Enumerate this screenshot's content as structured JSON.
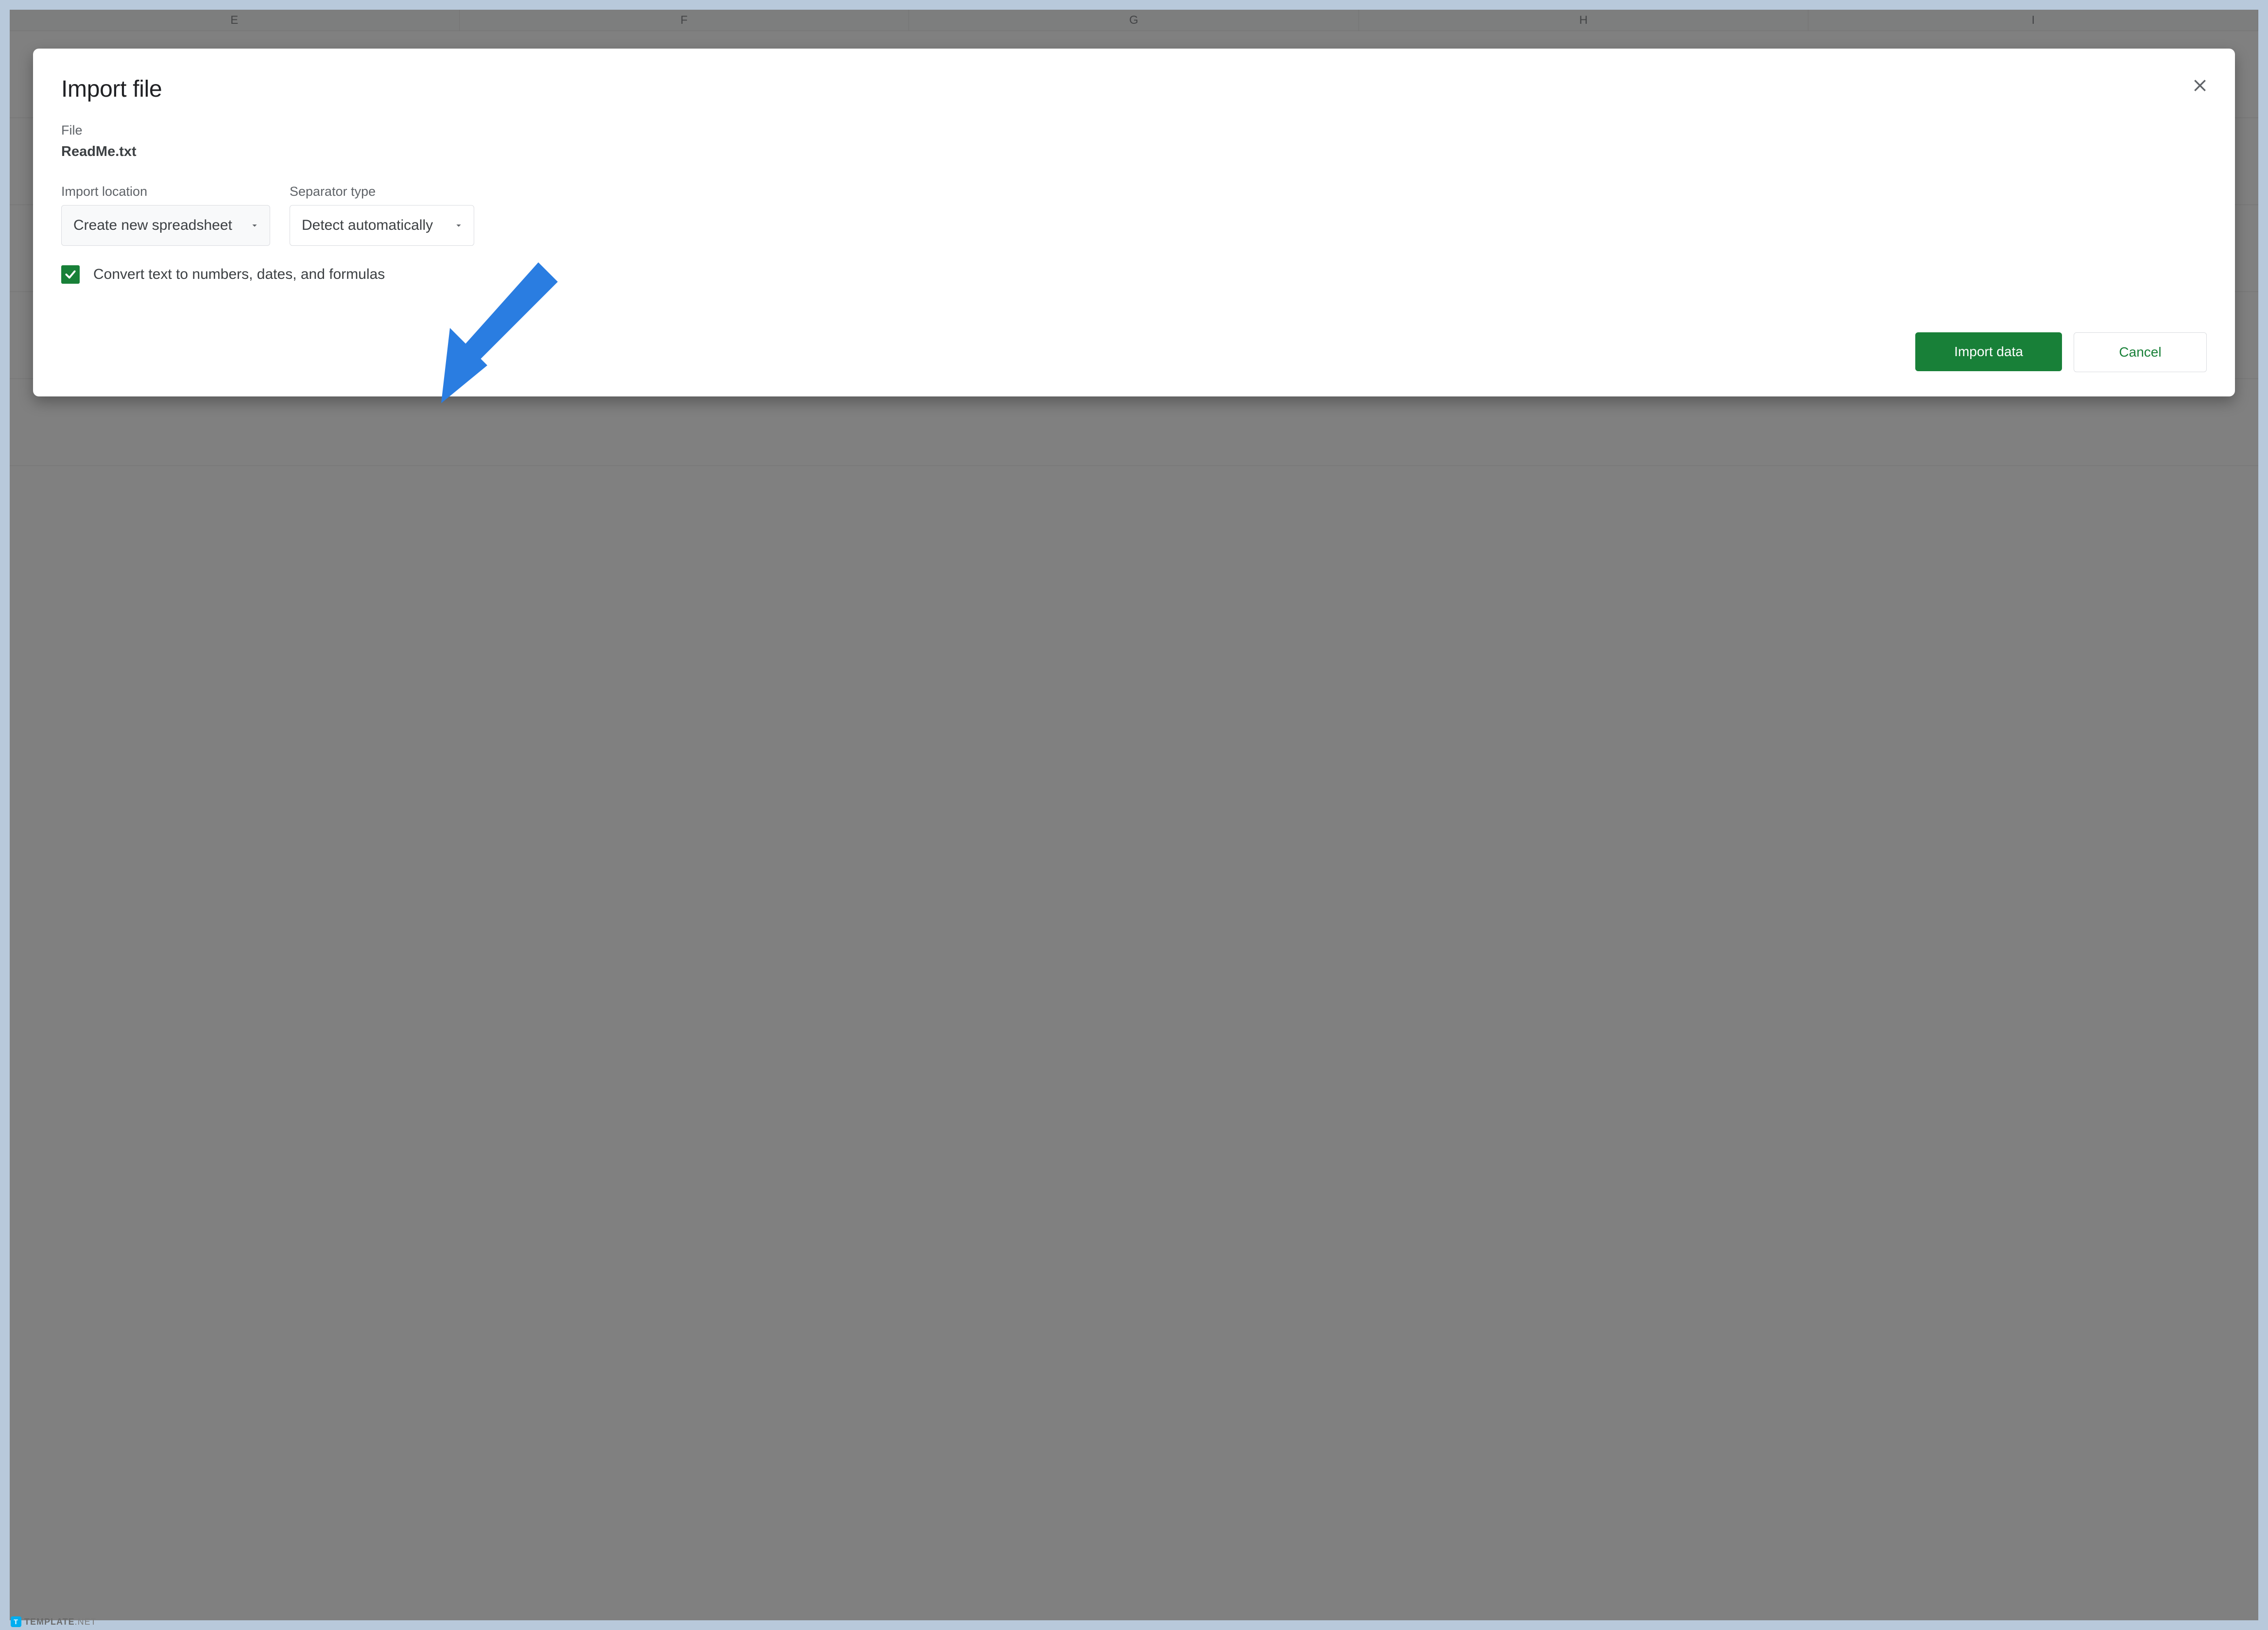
{
  "columns": [
    "E",
    "F",
    "G",
    "H",
    "I"
  ],
  "dialog": {
    "title": "Import file",
    "file_label": "File",
    "file_name": "ReadMe.txt",
    "import_location_label": "Import location",
    "import_location_value": "Create new spreadsheet",
    "separator_type_label": "Separator type",
    "separator_type_value": "Detect automatically",
    "convert_checkbox_label": "Convert text to numbers, dates, and formulas",
    "convert_checked": true,
    "import_button": "Import data",
    "cancel_button": "Cancel"
  },
  "watermark": {
    "badge": "T",
    "text_bold": "TEMPLATE",
    "text_light": ".NET"
  },
  "colors": {
    "accent_green": "#188038",
    "arrow_blue": "#2a7de1"
  }
}
